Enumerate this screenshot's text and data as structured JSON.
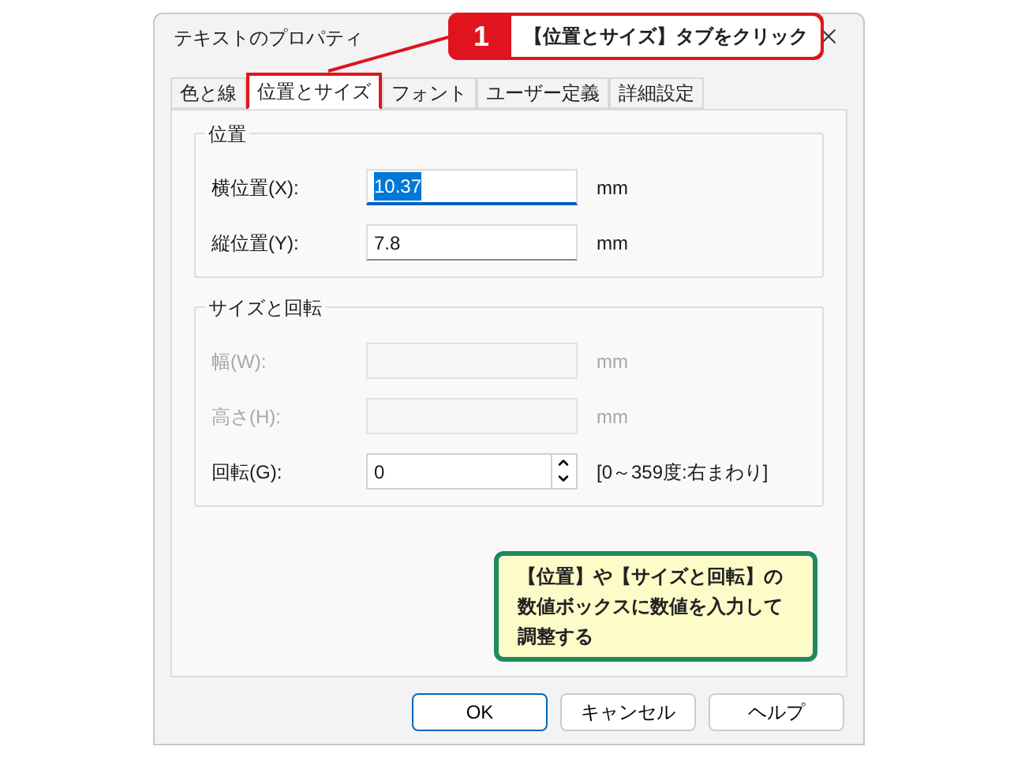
{
  "window": {
    "title": "テキストのプロパティ"
  },
  "tabs": [
    {
      "label": "色と線",
      "selected": false
    },
    {
      "label": "位置とサイズ",
      "selected": true
    },
    {
      "label": "フォント",
      "selected": false
    },
    {
      "label": "ユーザー定義",
      "selected": false
    },
    {
      "label": "詳細設定",
      "selected": false
    }
  ],
  "groups": [
    {
      "title": "位置",
      "fields": [
        {
          "kind": "text",
          "label": "横位置(X):",
          "value": "10.37",
          "unit": "mm",
          "focused": true,
          "disabled": false
        },
        {
          "kind": "text",
          "label": "縦位置(Y):",
          "value": "7.8",
          "unit": "mm",
          "focused": false,
          "disabled": false
        }
      ]
    },
    {
      "title": "サイズと回転",
      "fields": [
        {
          "kind": "text",
          "label": "幅(W):",
          "unit": "mm",
          "focused": false,
          "disabled": true
        },
        {
          "kind": "text",
          "label": "高さ(H):",
          "unit": "mm",
          "focused": false,
          "disabled": true
        },
        {
          "kind": "spinner",
          "label": "回転(G):",
          "value": "0",
          "unit": "[0～359度:右まわり]",
          "focused": false,
          "disabled": false
        }
      ]
    }
  ],
  "buttons": [
    {
      "label": "OK",
      "default": true
    },
    {
      "label": "キャンセル",
      "default": false
    },
    {
      "label": "ヘルプ",
      "default": false
    }
  ],
  "callouts": [
    {
      "kind": "step",
      "number": "1",
      "text": "【位置とサイズ】タブをクリック"
    },
    {
      "kind": "note",
      "lines": [
        "【位置】や【サイズと回転】の",
        "数値ボックスに数値を入力して",
        "調整する"
      ]
    }
  ]
}
